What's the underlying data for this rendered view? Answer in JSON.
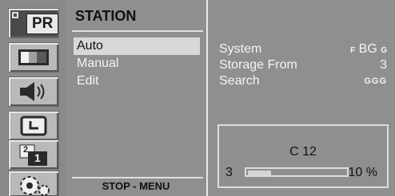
{
  "sidebar": {
    "icons": [
      {
        "name": "program-icon",
        "label": "PR",
        "active": true
      },
      {
        "name": "picture-icon"
      },
      {
        "name": "sound-icon"
      },
      {
        "name": "time-icon"
      },
      {
        "name": "multi-screen-icon",
        "digits": [
          "2",
          "1"
        ]
      },
      {
        "name": "settings-gear-icon"
      }
    ]
  },
  "menu": {
    "title": "STATION",
    "items": [
      {
        "label": "Auto",
        "selected": true
      },
      {
        "label": "Manual",
        "selected": false
      },
      {
        "label": "Edit",
        "selected": false
      }
    ],
    "footer": "STOP - MENU"
  },
  "info": {
    "system": {
      "label": "System",
      "prefix": "F",
      "value": "BG",
      "suffix": "G"
    },
    "storage_from": {
      "label": "Storage From",
      "value": "3"
    },
    "search": {
      "label": "Search",
      "value": "GGG"
    }
  },
  "scan": {
    "channel": "C 12",
    "start": "3",
    "progress_percent": 10,
    "percent_text": "10 %"
  },
  "colors": {
    "panel_bg": "#8f8f8f",
    "text_light": "#f4f4f4",
    "text_dark": "#111111",
    "highlight": "#d8d8d8",
    "border_light": "#e0e0e0"
  }
}
